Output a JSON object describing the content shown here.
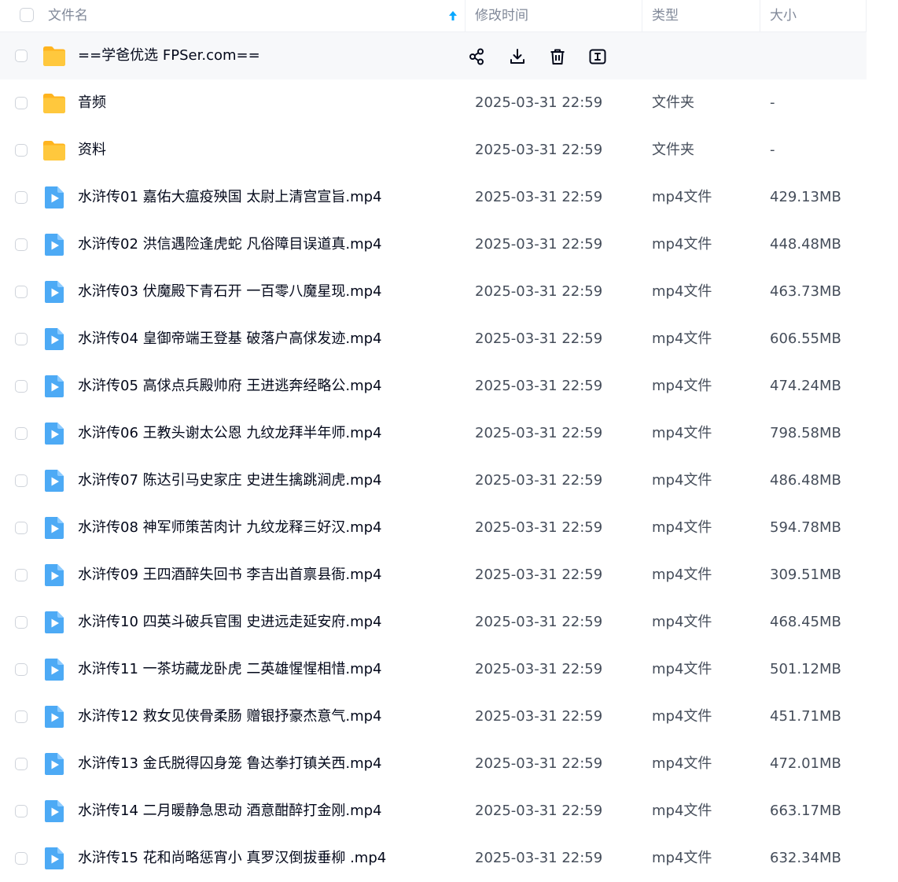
{
  "header": {
    "name_label": "文件名",
    "modified_label": "修改时间",
    "type_label": "类型",
    "size_label": "大小",
    "sort_icon": "arrow-up-icon",
    "accent_color": "#06a7ff"
  },
  "rows": [
    {
      "name": "==学爸优选 FPSer.com==",
      "date": "",
      "type": "",
      "size": "",
      "kind": "folder",
      "hover": true
    },
    {
      "name": "音频",
      "date": "2025-03-31 22:59",
      "type": "文件夹",
      "size": "-",
      "kind": "folder"
    },
    {
      "name": "资料",
      "date": "2025-03-31 22:59",
      "type": "文件夹",
      "size": "-",
      "kind": "folder"
    },
    {
      "name": "水浒传01 嘉佑大瘟疫殃国 太尉上清宫宣旨.mp4",
      "date": "2025-03-31 22:59",
      "type": "mp4文件",
      "size": "429.13MB",
      "kind": "video"
    },
    {
      "name": "水浒传02 洪信遇险逢虎蛇 凡俗障目误道真.mp4",
      "date": "2025-03-31 22:59",
      "type": "mp4文件",
      "size": "448.48MB",
      "kind": "video"
    },
    {
      "name": "水浒传03 伏魔殿下青石开 一百零八魔星现.mp4",
      "date": "2025-03-31 22:59",
      "type": "mp4文件",
      "size": "463.73MB",
      "kind": "video"
    },
    {
      "name": "水浒传04 皇御帝端王登基 破落户高俅发迹.mp4",
      "date": "2025-03-31 22:59",
      "type": "mp4文件",
      "size": "606.55MB",
      "kind": "video"
    },
    {
      "name": "水浒传05 高俅点兵殿帅府 王进逃奔经略公.mp4",
      "date": "2025-03-31 22:59",
      "type": "mp4文件",
      "size": "474.24MB",
      "kind": "video"
    },
    {
      "name": "水浒传06 王教头谢太公恩 九纹龙拜半年师.mp4",
      "date": "2025-03-31 22:59",
      "type": "mp4文件",
      "size": "798.58MB",
      "kind": "video"
    },
    {
      "name": "水浒传07 陈达引马史家庄 史进生擒跳涧虎.mp4",
      "date": "2025-03-31 22:59",
      "type": "mp4文件",
      "size": "486.48MB",
      "kind": "video"
    },
    {
      "name": "水浒传08 神军师策苦肉计 九纹龙释三好汉.mp4",
      "date": "2025-03-31 22:59",
      "type": "mp4文件",
      "size": "594.78MB",
      "kind": "video"
    },
    {
      "name": "水浒传09 王四酒醉失回书 李吉出首禀县衙.mp4",
      "date": "2025-03-31 22:59",
      "type": "mp4文件",
      "size": "309.51MB",
      "kind": "video"
    },
    {
      "name": "水浒传10 四英斗破兵官围 史进远走延安府.mp4",
      "date": "2025-03-31 22:59",
      "type": "mp4文件",
      "size": "468.45MB",
      "kind": "video"
    },
    {
      "name": "水浒传11 一茶坊藏龙卧虎 二英雄惺惺相惜.mp4",
      "date": "2025-03-31 22:59",
      "type": "mp4文件",
      "size": "501.12MB",
      "kind": "video"
    },
    {
      "name": "水浒传12 救女见侠骨柔肠 赠银抒豪杰意气.mp4",
      "date": "2025-03-31 22:59",
      "type": "mp4文件",
      "size": "451.71MB",
      "kind": "video"
    },
    {
      "name": "水浒传13 金氏脱得囚身笼 鲁达拳打镇关西.mp4",
      "date": "2025-03-31 22:59",
      "type": "mp4文件",
      "size": "472.01MB",
      "kind": "video"
    },
    {
      "name": "水浒传14 二月暖静急思动 酒意酣醉打金刚.mp4",
      "date": "2025-03-31 22:59",
      "type": "mp4文件",
      "size": "663.17MB",
      "kind": "video"
    },
    {
      "name": "水浒传15 花和尚略惩宵小 真罗汉倒拔垂柳 .mp4",
      "date": "2025-03-31 22:59",
      "type": "mp4文件",
      "size": "632.34MB",
      "kind": "video"
    }
  ],
  "hover_actions": [
    {
      "icon": "share-icon"
    },
    {
      "icon": "download-icon"
    },
    {
      "icon": "delete-icon"
    },
    {
      "icon": "rename-icon"
    }
  ],
  "colors": {
    "folder": "#ffc83d",
    "video": "#4daaf5",
    "hover_bg": "#f7f8fa"
  }
}
